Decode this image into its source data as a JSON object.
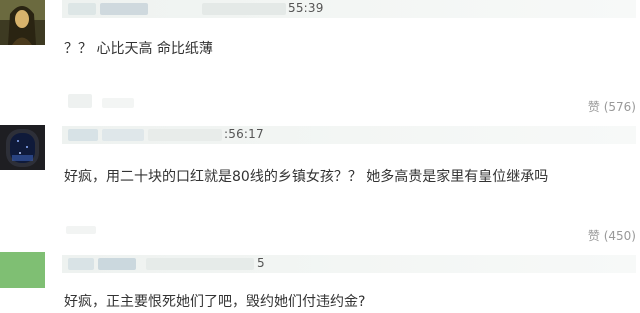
{
  "comments": [
    {
      "time": "55:39",
      "text": "？？ 心比天高 命比纸薄"
    },
    {
      "time": ":56:17",
      "text": "好疯，用二十块的口红就是80线的乡镇女孩？？ 她多高贵是家里有皇位继承吗",
      "like_label": "赞",
      "like_count": "(576)"
    },
    {
      "time": "5",
      "text": "好疯，正主要恨死她们了吧，毁约她们付违约金?",
      "like_label": "赞",
      "like_count": "(450)"
    }
  ],
  "colors": {
    "text": "#333333",
    "meta": "#555555",
    "like": "#999999",
    "meta_bar": "#eef2f0"
  },
  "icons": {
    "avatar_1": "portrait-painting",
    "avatar_2": "airplane-window-night",
    "avatar_3": "green-solid"
  }
}
